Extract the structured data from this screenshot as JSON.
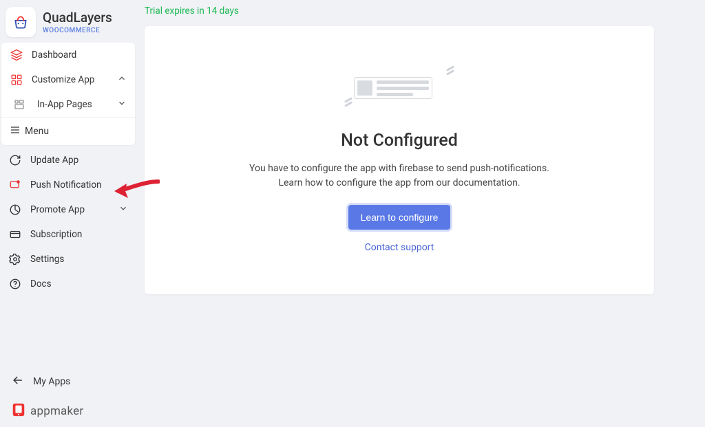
{
  "brand": {
    "title": "QuadLayers",
    "subtitle": "WOOCOMMERCE"
  },
  "sidebar": {
    "dashboard": "Dashboard",
    "customize": "Customize App",
    "inapp": "In-App Pages",
    "menu_label": "Menu",
    "update": "Update App",
    "push": "Push Notification",
    "promote": "Promote App",
    "subscription": "Subscription",
    "settings": "Settings",
    "docs": "Docs",
    "myapps": "My Apps",
    "appmaker": "appmaker"
  },
  "trial_text": "Trial expires in 14 days",
  "empty": {
    "title": "Not Configured",
    "line1": "You have to configure the app with firebase to send push-notifications.",
    "line2": "Learn how to configure the app from our documentation.",
    "button": "Learn to configure",
    "support": "Contact support"
  }
}
